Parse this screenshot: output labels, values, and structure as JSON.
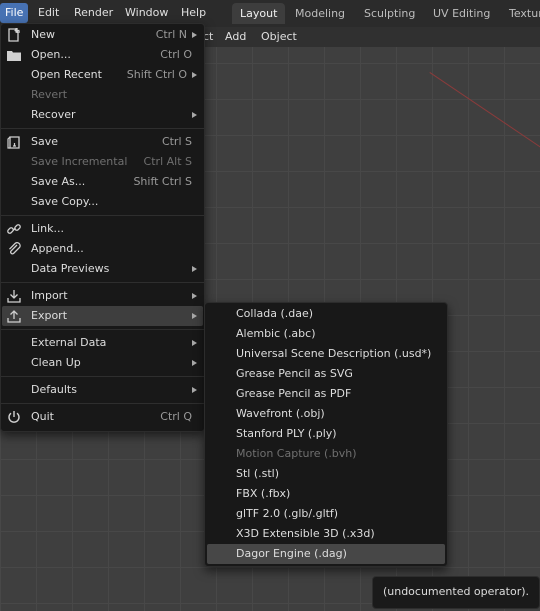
{
  "topbar": {
    "menus": [
      "File",
      "Edit",
      "Render",
      "Window",
      "Help"
    ],
    "workspace_tabs": [
      "Layout",
      "Modeling",
      "Sculpting",
      "UV Editing",
      "Textur"
    ]
  },
  "viewport_header": {
    "items": [
      "ct",
      "Add",
      "Object"
    ]
  },
  "file_menu": {
    "new": {
      "label": "New",
      "shortcut": "Ctrl N"
    },
    "open": {
      "label": "Open...",
      "shortcut": "Ctrl O"
    },
    "open_recent": {
      "label": "Open Recent",
      "shortcut": "Shift Ctrl O"
    },
    "revert": {
      "label": "Revert"
    },
    "recover": {
      "label": "Recover"
    },
    "save": {
      "label": "Save",
      "shortcut": "Ctrl S"
    },
    "save_incremental": {
      "label": "Save Incremental",
      "shortcut": "Ctrl Alt S"
    },
    "save_as": {
      "label": "Save As...",
      "shortcut": "Shift Ctrl S"
    },
    "save_copy": {
      "label": "Save Copy..."
    },
    "link": {
      "label": "Link..."
    },
    "append": {
      "label": "Append..."
    },
    "data_previews": {
      "label": "Data Previews"
    },
    "import": {
      "label": "Import"
    },
    "export": {
      "label": "Export"
    },
    "external_data": {
      "label": "External Data"
    },
    "clean_up": {
      "label": "Clean Up"
    },
    "defaults": {
      "label": "Defaults"
    },
    "quit": {
      "label": "Quit",
      "shortcut": "Ctrl Q"
    }
  },
  "export_menu": {
    "items": [
      "Collada (.dae)",
      "Alembic (.abc)",
      "Universal Scene Description (.usd*)",
      "Grease Pencil as SVG",
      "Grease Pencil as PDF",
      "Wavefront (.obj)",
      "Stanford PLY (.ply)",
      "Motion Capture (.bvh)",
      "Stl (.stl)",
      "FBX (.fbx)",
      "glTF 2.0 (.glb/.gltf)",
      "X3D Extensible 3D (.x3d)",
      "Dagor Engine (.dag)"
    ],
    "disabled_index": 7,
    "highlighted_index": 12
  },
  "tooltip": {
    "text": "(undocumented operator)."
  },
  "colors": {
    "accent": "#4772b3",
    "menu_bg": "#181818",
    "viewport_bg": "#3f3f3f"
  }
}
